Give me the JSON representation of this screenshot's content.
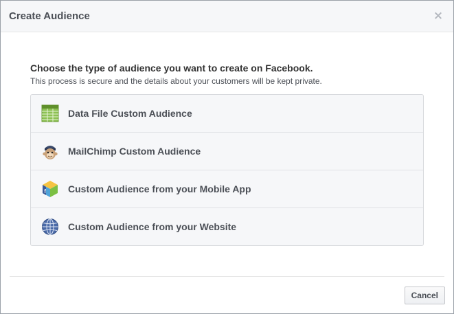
{
  "dialog": {
    "title": "Create Audience",
    "close_symbol": "×"
  },
  "content": {
    "heading": "Choose the type of audience you want to create on Facebook.",
    "subheading": "This process is secure and the details about your customers will be kept private."
  },
  "options": [
    {
      "label": "Data File Custom Audience",
      "icon": "spreadsheet-icon"
    },
    {
      "label": "MailChimp Custom Audience",
      "icon": "mailchimp-icon"
    },
    {
      "label": "Custom Audience from your Mobile App",
      "icon": "mobile-app-icon"
    },
    {
      "label": "Custom Audience from your Website",
      "icon": "globe-icon"
    }
  ],
  "footer": {
    "cancel_label": "Cancel"
  },
  "colors": {
    "header_bg": "#f6f7f9",
    "option_bg": "#f6f7f9",
    "text_dark": "#4b4f56",
    "spreadsheet_green": "#8cc152"
  }
}
